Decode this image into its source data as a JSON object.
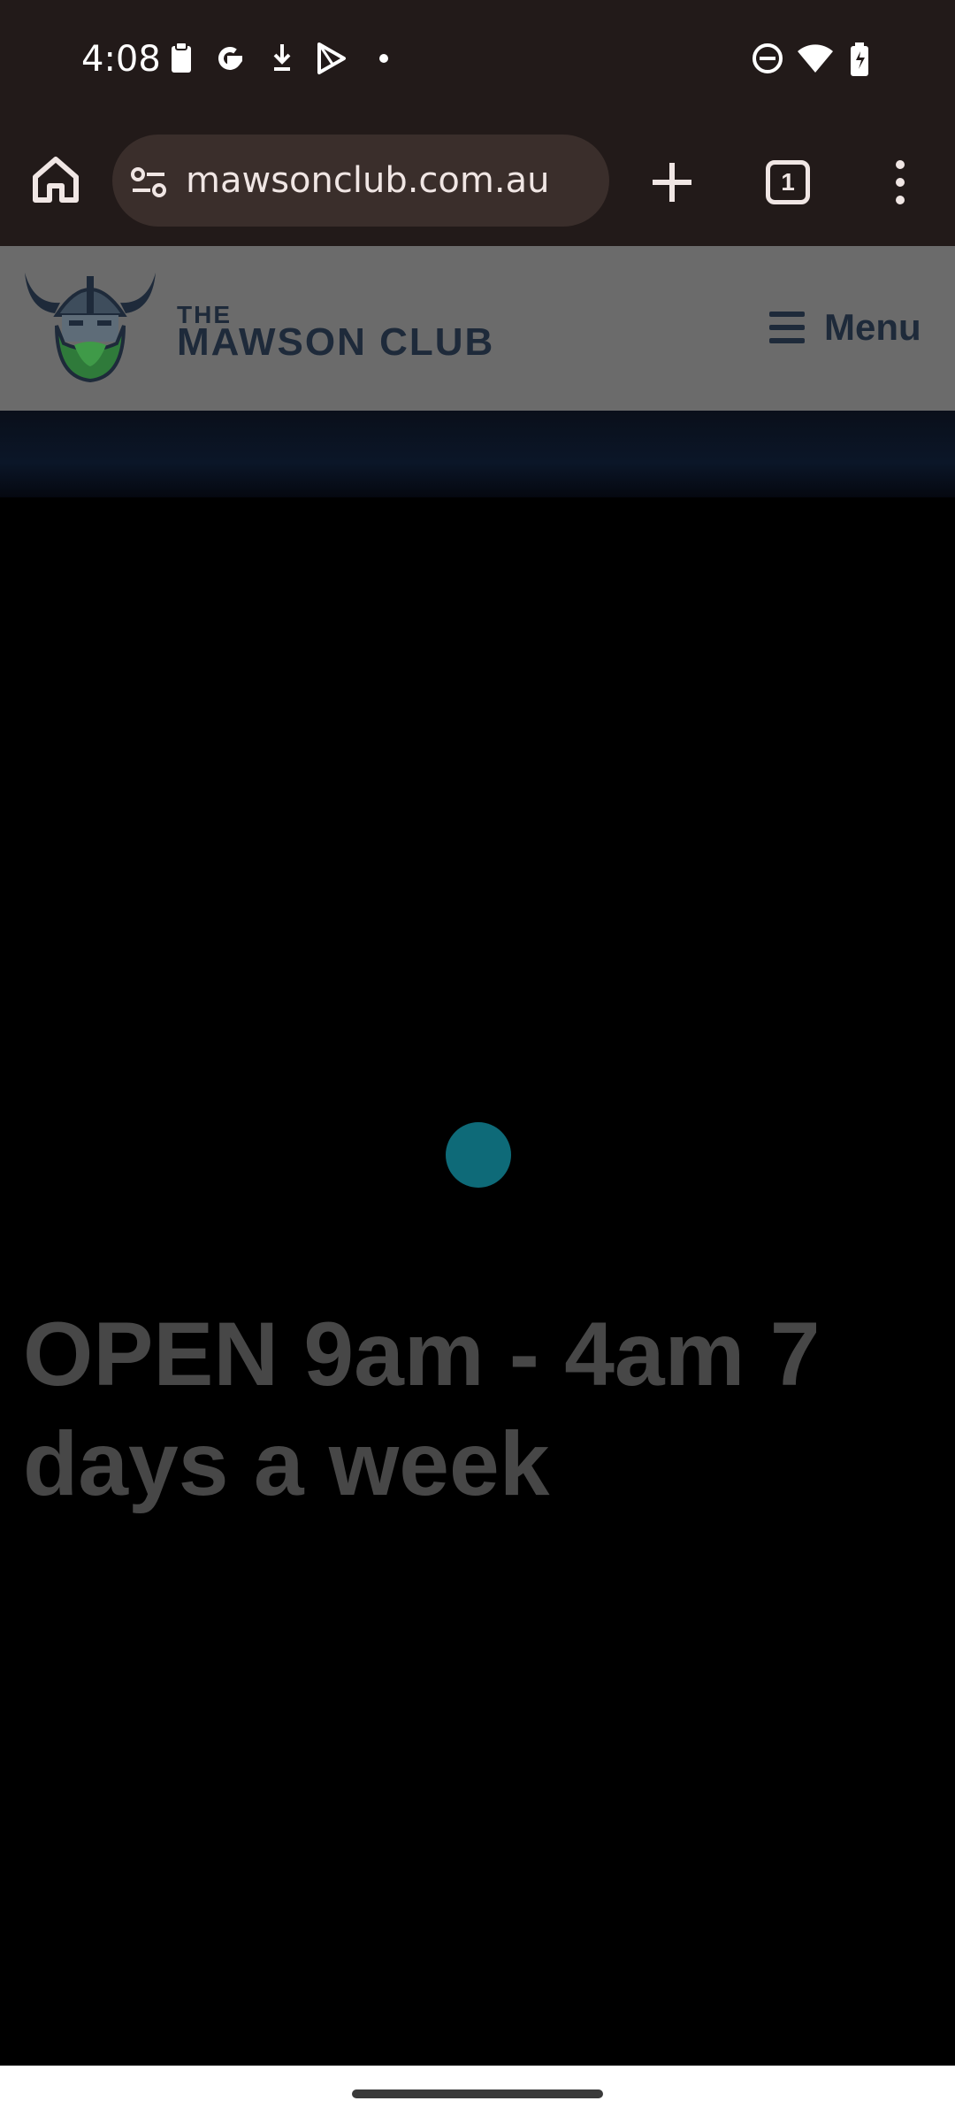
{
  "status_bar": {
    "time": "4:08",
    "icons": [
      "clipboard-icon",
      "google-icon",
      "download-icon",
      "play-store-icon",
      "dot-icon",
      "dnd-icon",
      "wifi-icon",
      "battery-icon"
    ]
  },
  "browser": {
    "url": "mawsonclub.com.au",
    "tab_count": "1"
  },
  "site": {
    "logo_text_top": "THE",
    "logo_text_main": "MAWSON CLUB",
    "menu_label": "Menu"
  },
  "main": {
    "headline": "OPEN 9am - 4am 7 days a week"
  },
  "colors": {
    "browser_bar": "#221a19",
    "urlbar": "#3a2e2b",
    "loader": "#0e6a78",
    "headline": "#474747"
  }
}
